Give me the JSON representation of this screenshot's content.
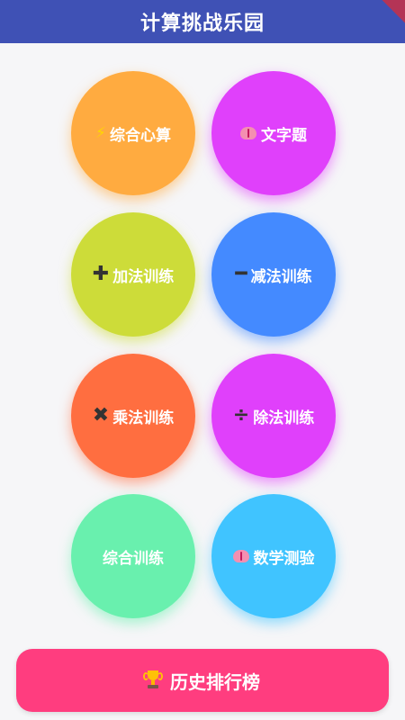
{
  "header": {
    "title": "计算挑战乐园"
  },
  "menu": {
    "items": [
      {
        "id": "mixed_mental",
        "icon": "lightning-icon",
        "label": "综合心算",
        "color": "#ffab40"
      },
      {
        "id": "word_problems",
        "icon": "brain-icon",
        "label": "文字题",
        "color": "#e040fb"
      },
      {
        "id": "addition",
        "icon": "plus-icon",
        "icon_glyph": "➕",
        "label": "加法训练",
        "color": "#cddc39"
      },
      {
        "id": "subtraction",
        "icon": "minus-icon",
        "icon_glyph": "➖",
        "label": "减法训练",
        "color": "#448aff"
      },
      {
        "id": "multiplication",
        "icon": "multiply-icon",
        "icon_glyph": "✖",
        "label": "乘法训练",
        "color": "#ff6e40"
      },
      {
        "id": "division",
        "icon": "divide-icon",
        "icon_glyph": "➗",
        "label": "除法训练",
        "color": "#e040fb"
      },
      {
        "id": "mixed_training",
        "icon": "",
        "label": "综合训练",
        "color": "#69f0ae"
      },
      {
        "id": "math_quiz",
        "icon": "brain-icon",
        "label": "数学测验",
        "color": "#40c4ff"
      }
    ]
  },
  "footer": {
    "history_label": "历史排行榜",
    "history_icon": "trophy-icon",
    "history_color": "#ff3d7f"
  },
  "theme": {
    "header_color": "#3f51b5",
    "background": "#f6f6f8"
  }
}
